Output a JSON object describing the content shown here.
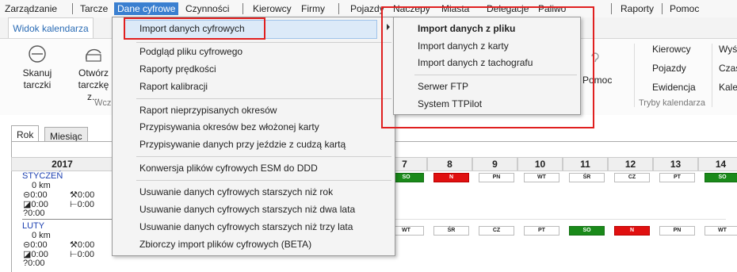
{
  "menubar": {
    "items": [
      "Zarządzanie",
      "Tarcze",
      "Dane cyfrowe",
      "Czynności",
      "Kierowcy",
      "Firmy",
      "Pojazdy",
      "Naczepy",
      "Miasta",
      "Delegacje",
      "Paliwo",
      "Raporty",
      "Pomoc"
    ]
  },
  "ribbon": {
    "tab": "Widok kalendarza",
    "buttons": {
      "scan": "Skanuj tarczki",
      "open": "Otwórz tarczkę z..."
    },
    "group_label_left": "Wcz",
    "help": "Pomoc",
    "right_small": [
      "Kierowcy",
      "Pojazdy",
      "Ewidencja"
    ],
    "far_right": [
      "Wyś",
      "Czas",
      "Kale"
    ],
    "group_label_right": "Tryby kalendarza"
  },
  "dropdown": {
    "items": [
      "Import danych cyfrowych",
      "Podgląd pliku cyfrowego",
      "Raporty prędkości",
      "Raport kalibracji",
      "Raport nieprzypisanych okresów",
      "Przypisywania okresów bez włożonej karty",
      "Przypisywanie danych przy jeździe z cudzą kartą",
      "Konwersja plików cyfrowych ESM do DDD",
      "Usuwanie danych cyfrowych starszych niż rok",
      "Usuwanie danych cyfrowych starszych niż dwa lata",
      "Usuwanie danych cyfrowych starszych niż trzy lata",
      "Zbiorczy import plików cyfrowych (BETA)"
    ]
  },
  "submenu": {
    "items": [
      "Import danych z pliku",
      "Import danych z karty",
      "Import danych z tachografu",
      "Serwer FTP",
      "System TTPilot"
    ]
  },
  "calendar": {
    "tabs": [
      "Rok",
      "Miesiąc"
    ],
    "year": "2017",
    "days": [
      "7",
      "8",
      "9",
      "10",
      "11",
      "12",
      "13",
      "14"
    ],
    "months": [
      {
        "name": "STYCZEŃ",
        "km": "0 km",
        "a": "0:00",
        "b": "0:00",
        "c": "0:00",
        "d": "0:00",
        "e": "0:00",
        "row": [
          {
            "label": "SO",
            "color": "green"
          },
          {
            "label": "N",
            "color": "red"
          },
          {
            "label": "PN",
            "color": "white"
          },
          {
            "label": "WT",
            "color": "white"
          },
          {
            "label": "ŚR",
            "color": "white"
          },
          {
            "label": "CZ",
            "color": "white"
          },
          {
            "label": "PT",
            "color": "white"
          },
          {
            "label": "SO",
            "color": "green"
          }
        ]
      },
      {
        "name": "LUTY",
        "km": "0 km",
        "a": "0:00",
        "b": "0:00",
        "c": "0:00",
        "d": "0:00",
        "e": "0:00",
        "row": [
          {
            "label": "WT",
            "color": "white"
          },
          {
            "label": "ŚR",
            "color": "white"
          },
          {
            "label": "CZ",
            "color": "white"
          },
          {
            "label": "PT",
            "color": "white"
          },
          {
            "label": "SO",
            "color": "green"
          },
          {
            "label": "N",
            "color": "red"
          },
          {
            "label": "PN",
            "color": "white"
          },
          {
            "label": "WT",
            "color": "white"
          }
        ]
      }
    ]
  },
  "colors": {
    "accent": "#3a7fd0",
    "highlight_box": "#e02020",
    "weekend_green": "#1a8a1a",
    "sunday_red": "#e01010"
  }
}
